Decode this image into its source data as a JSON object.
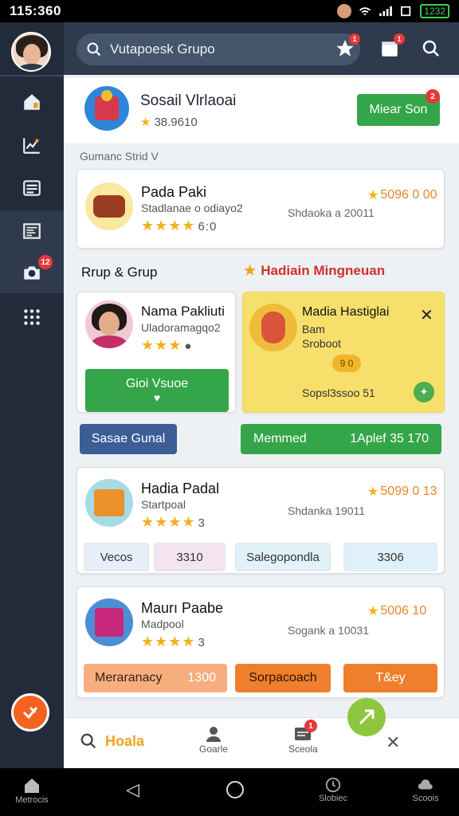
{
  "status": {
    "time": "115:360",
    "battery": "1232"
  },
  "rail": {
    "items": [
      {
        "name": "home-icon"
      },
      {
        "name": "chart-icon"
      },
      {
        "name": "list-icon"
      },
      {
        "name": "document-icon"
      },
      {
        "name": "camera-icon",
        "badge": "12"
      },
      {
        "name": "apps-icon"
      }
    ]
  },
  "search": {
    "placeholder": "Vutapoesk Grupo",
    "star_badge": "1",
    "bag_badge": "1"
  },
  "header": {
    "title": "Sosail Vlrlaoai",
    "rating": "38.9610",
    "button": "Miear Son",
    "button_badge": "2"
  },
  "section1": {
    "label": "Gumanc Strid V"
  },
  "card1": {
    "title": "Pada Paki",
    "sub": "Stadlanae o odiayo2",
    "rating": "6:0",
    "price": "5096 0 00",
    "meta": "Shdaoka a 20011"
  },
  "section2": {
    "left": "Rrup & Grup",
    "right": "Hadiain Mingneuan"
  },
  "profile": {
    "name": "Nama Pakliuti",
    "sub": "Uladoramagqo2",
    "btn": "Gioi Vsuoe"
  },
  "promo": {
    "title": "Madia Hastiglai",
    "line1": "Bam",
    "line2": "Sroboot",
    "coin": "9 0",
    "footer": "Sopsl3ssoo 51"
  },
  "row_actions": {
    "left": "Sasae Gunal",
    "right_label": "Memmed",
    "right_value": "1Aplef 35 170"
  },
  "card2": {
    "title": "Hadia Padal",
    "sub": "Startpoal",
    "rating": "3",
    "price": "5099 0 13",
    "meta": "Shdanka 19011",
    "chips": [
      "Vecos",
      "3310",
      "Salegopondla",
      "3306"
    ]
  },
  "card3": {
    "title": "Maurı Paabe",
    "sub": "Madpool",
    "rating": "3",
    "price": "5006 10",
    "meta": "Sogank a 10031",
    "actions": [
      "Meraranacy",
      "1300",
      "Sorpacoach",
      "T&ey"
    ]
  },
  "bottom": {
    "search_label": "Hoala",
    "tab1": "Goarle",
    "tab2": "Sceola",
    "tab2_badge": "1"
  },
  "navbar": {
    "left": "Metrocis",
    "mid1": "Slobiec",
    "mid2": "Scoois"
  }
}
